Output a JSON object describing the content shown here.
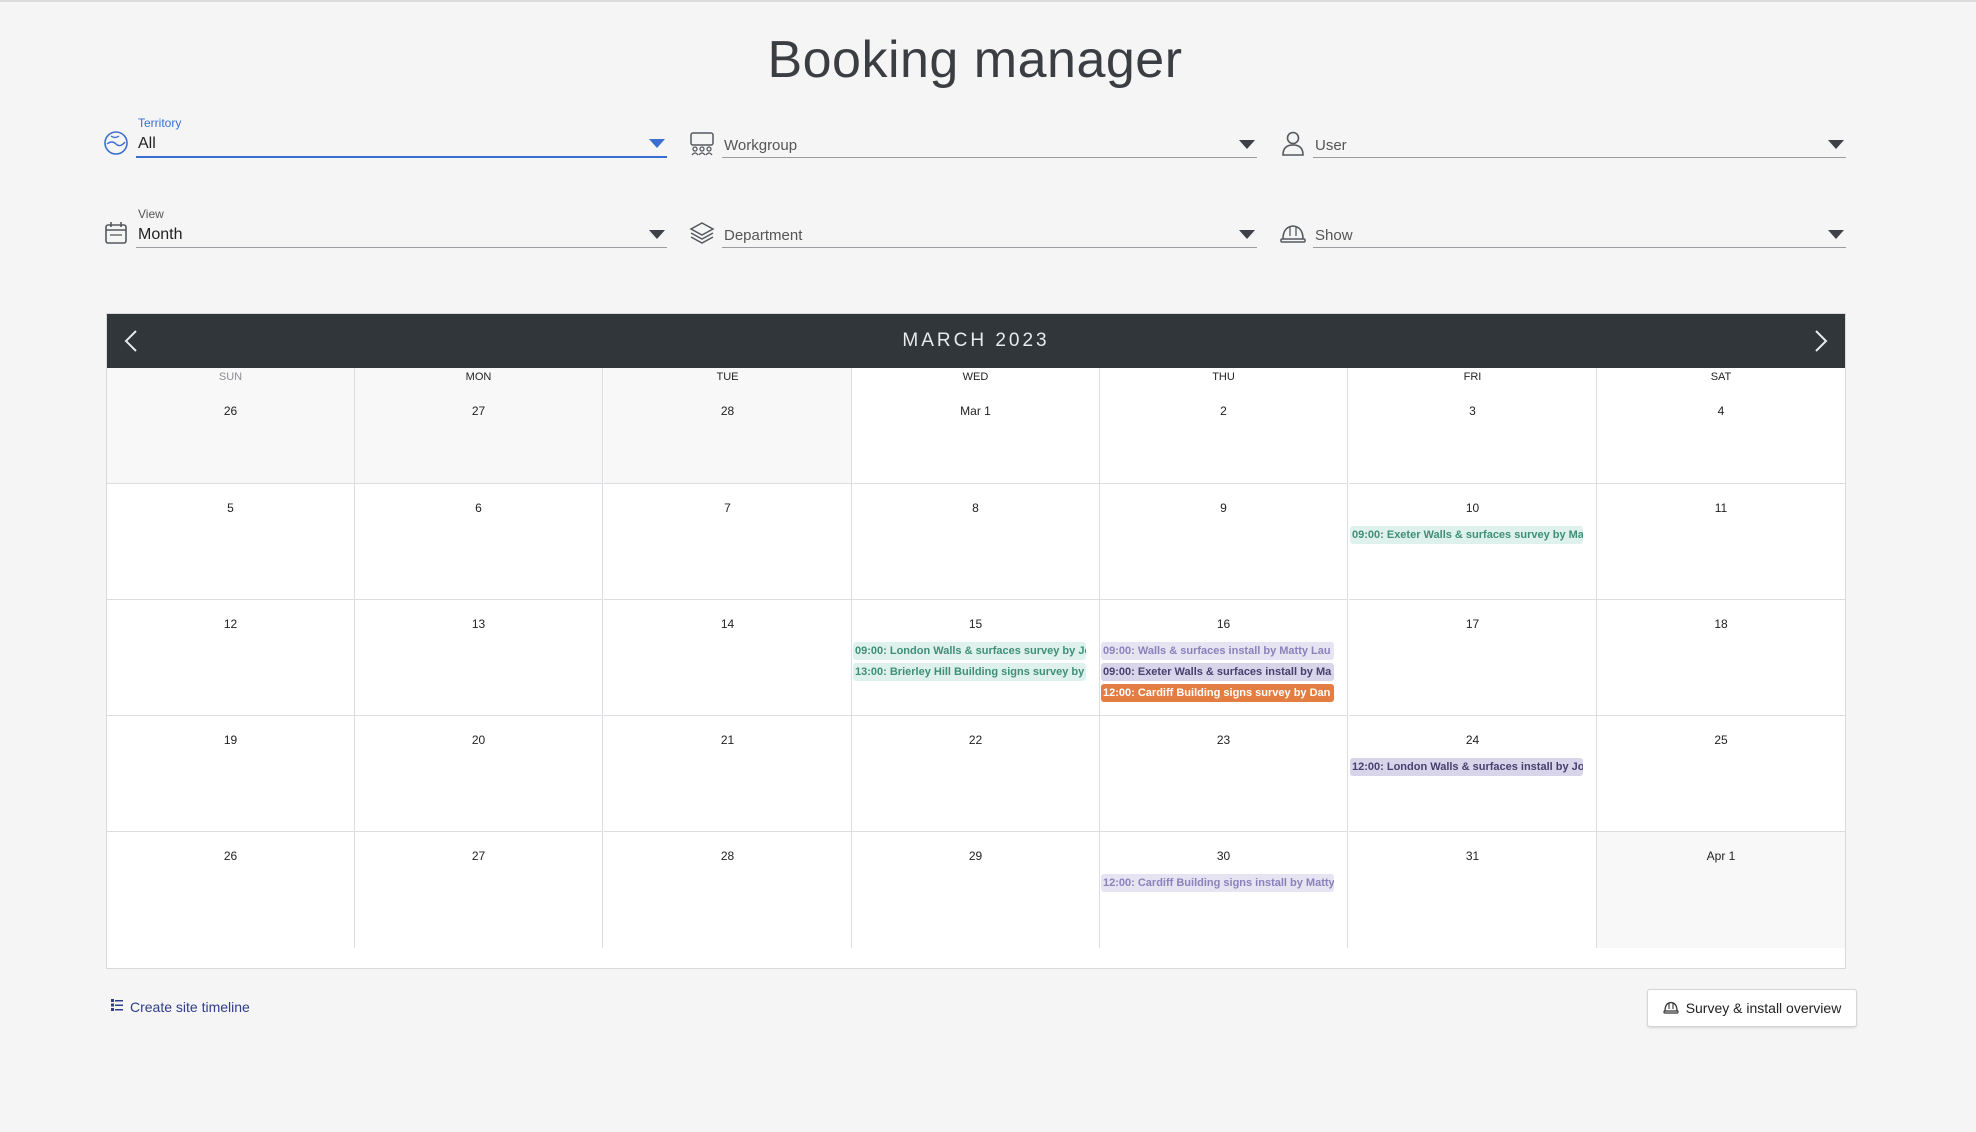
{
  "page": {
    "title": "Booking manager"
  },
  "filters": {
    "territory": {
      "label": "Territory",
      "value": "All"
    },
    "workgroup": {
      "placeholder": "Workgroup"
    },
    "user": {
      "placeholder": "User"
    },
    "view": {
      "label": "View",
      "value": "Month"
    },
    "department": {
      "placeholder": "Department"
    },
    "show": {
      "placeholder": "Show"
    }
  },
  "calendar": {
    "month_title": "MARCH 2023",
    "days_of_week": [
      "SUN",
      "MON",
      "TUE",
      "WED",
      "THU",
      "FRI",
      "SAT"
    ],
    "weeks": [
      [
        "26",
        "27",
        "28",
        "Mar 1",
        "2",
        "3",
        "4"
      ],
      [
        "5",
        "6",
        "7",
        "8",
        "9",
        "10",
        "11"
      ],
      [
        "12",
        "13",
        "14",
        "15",
        "16",
        "17",
        "18"
      ],
      [
        "19",
        "20",
        "21",
        "22",
        "23",
        "24",
        "25"
      ],
      [
        "26",
        "27",
        "28",
        "29",
        "30",
        "31",
        "Apr 1"
      ]
    ],
    "events": [
      {
        "week": 1,
        "day": 5,
        "slot": 0,
        "style": "survey",
        "text": "09:00: Exeter Walls & surfaces survey by Ma"
      },
      {
        "week": 2,
        "day": 3,
        "slot": 0,
        "style": "survey",
        "text": "09:00: London Walls & surfaces survey by Jo"
      },
      {
        "week": 2,
        "day": 3,
        "slot": 1,
        "style": "survey",
        "text": "13:00: Brierley Hill Building signs survey by"
      },
      {
        "week": 2,
        "day": 4,
        "slot": 0,
        "style": "install-light",
        "text": "09:00: Walls & surfaces install by Matty Lau"
      },
      {
        "week": 2,
        "day": 4,
        "slot": 1,
        "style": "install-dark",
        "text": "09:00: Exeter Walls & surfaces install by Ma"
      },
      {
        "week": 2,
        "day": 4,
        "slot": 2,
        "style": "orange",
        "text": "12:00: Cardiff Building signs survey by Dan ("
      },
      {
        "week": 3,
        "day": 5,
        "slot": 0,
        "style": "install-dark",
        "text": "12:00: London Walls & surfaces install by Jo"
      },
      {
        "week": 4,
        "day": 4,
        "slot": 0,
        "style": "install-light",
        "text": "12:00: Cardiff Building signs install by Matty"
      }
    ]
  },
  "footer": {
    "timeline_link": "Create site timeline",
    "overview_button": "Survey & install overview"
  }
}
